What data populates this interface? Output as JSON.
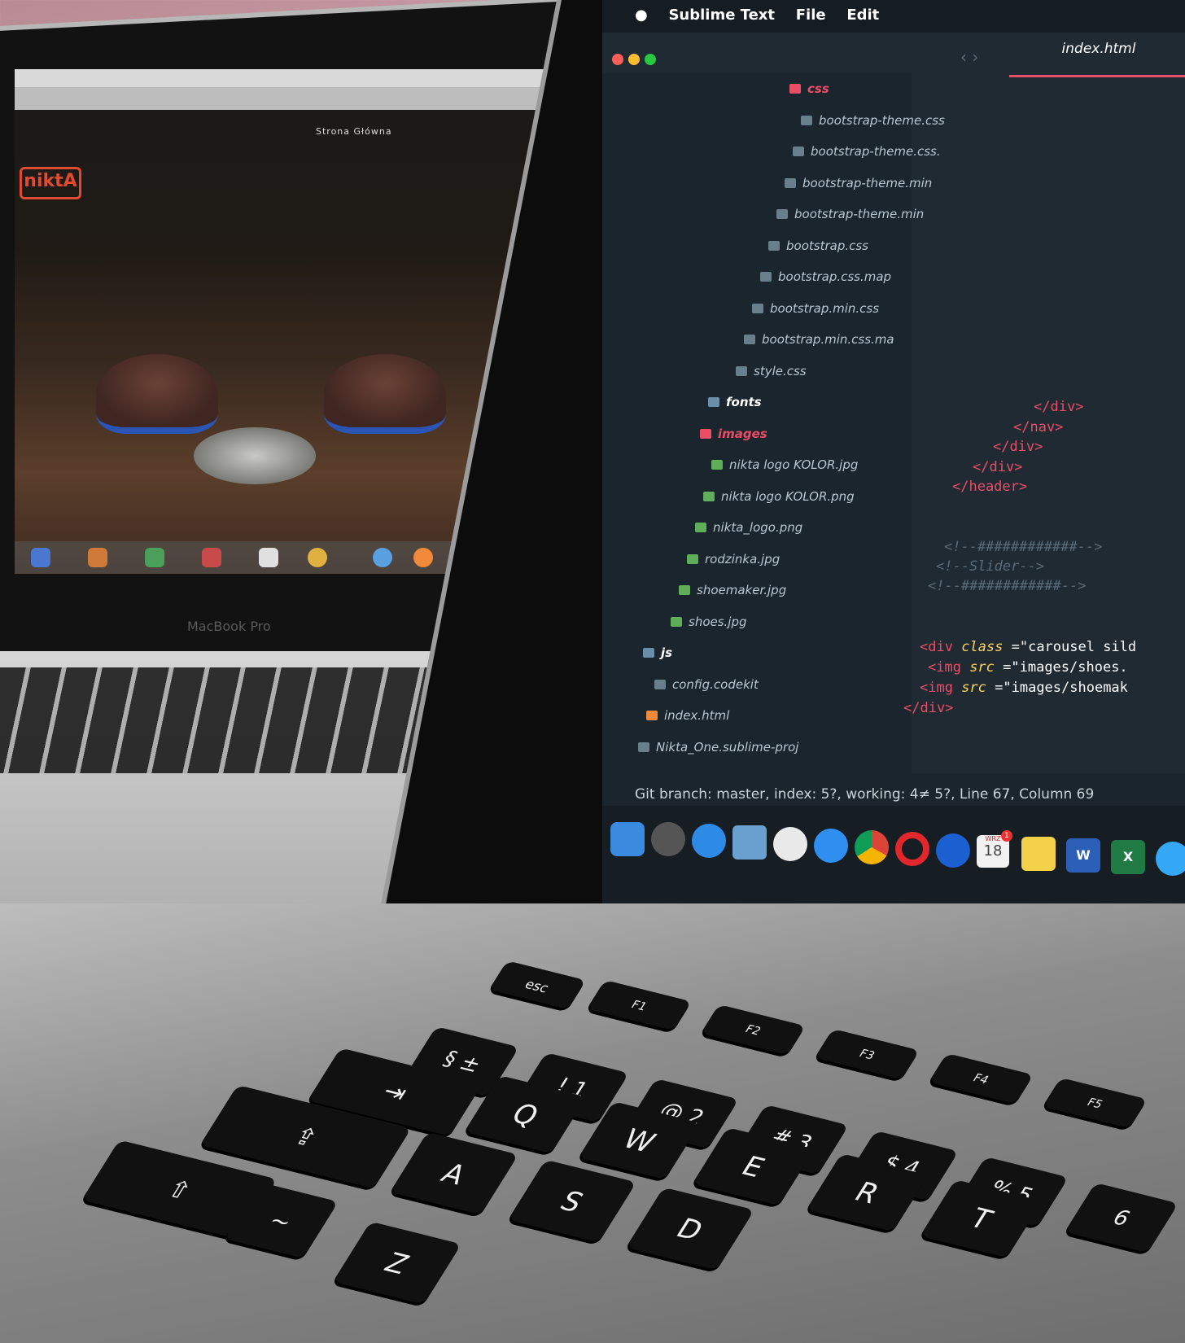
{
  "back_screen": {
    "nav_active": "Strona Główna",
    "logo_text": "niktA",
    "brand": "MacBook Pro"
  },
  "editor": {
    "menu": [
      "Sublime Text",
      "File",
      "Edit"
    ],
    "tab_title": "index.html",
    "sidebar": [
      {
        "label": "css",
        "kind": "folder-open"
      },
      {
        "label": "bootstrap-theme.css",
        "kind": "file"
      },
      {
        "label": "bootstrap-theme.css.",
        "kind": "file"
      },
      {
        "label": "bootstrap-theme.min",
        "kind": "file"
      },
      {
        "label": "bootstrap-theme.min",
        "kind": "file"
      },
      {
        "label": "bootstrap.css",
        "kind": "file"
      },
      {
        "label": "bootstrap.css.map",
        "kind": "file"
      },
      {
        "label": "bootstrap.min.css",
        "kind": "file"
      },
      {
        "label": "bootstrap.min.css.ma",
        "kind": "file"
      },
      {
        "label": "style.css",
        "kind": "file"
      },
      {
        "label": "fonts",
        "kind": "folder"
      },
      {
        "label": "images",
        "kind": "folder-open"
      },
      {
        "label": "nikta logo KOLOR.jpg",
        "kind": "image"
      },
      {
        "label": "nikta logo KOLOR.png",
        "kind": "image"
      },
      {
        "label": "nikta_logo.png",
        "kind": "image"
      },
      {
        "label": "rodzinka.jpg",
        "kind": "image"
      },
      {
        "label": "shoemaker.jpg",
        "kind": "image"
      },
      {
        "label": "shoes.jpg",
        "kind": "image"
      },
      {
        "label": "js",
        "kind": "folder"
      },
      {
        "label": "config.codekit",
        "kind": "file"
      },
      {
        "label": "index.html",
        "kind": "html"
      },
      {
        "label": "Nikta_One.sublime-proj",
        "kind": "project"
      }
    ],
    "code_lines": [
      {
        "text": "</div>",
        "cls": "tag"
      },
      {
        "text": "</nav>",
        "cls": "tag"
      },
      {
        "text": "</div>",
        "cls": "tag"
      },
      {
        "text": "</div>",
        "cls": "tag"
      },
      {
        "text": "</header>",
        "cls": "tag"
      },
      {
        "text": "<!--############-->",
        "cls": "cmt"
      },
      {
        "text": "<!--Slider-->",
        "cls": "cmt"
      },
      {
        "text": "<!--############-->",
        "cls": "cmt"
      }
    ],
    "code_tail": {
      "div_tag": "<div",
      "class_attr": "class",
      "class_value": "=\"carousel sild",
      "img_tag": "<img",
      "src_attr": "src",
      "src_value_1": "=\"images/shoes.",
      "src_value_2": "=\"images/shoemak",
      "close_div": "</div>"
    },
    "status": "Git branch: master, index: 5?, working: 4≠ 5?, Line 67, Column 69"
  },
  "dock_calendar": {
    "month": "WRZ",
    "day": "18",
    "badge": "1"
  },
  "keyboard": {
    "esc": "esc",
    "row_numbers": [
      "§ ±",
      "! 1",
      "@ 2",
      "# 3",
      "$ 4",
      "% 5",
      "6"
    ],
    "row_fn": [
      "F1",
      "F2",
      "F3",
      "F4",
      "F5"
    ],
    "row_q": [
      "Q",
      "W",
      "E",
      "R",
      "T"
    ],
    "row_a": [
      "A",
      "S",
      "D"
    ],
    "tab_glyph": "⇥",
    "shift_glyph": "⇧",
    "caps_glyph": "⇪",
    "z": "Z",
    "tilde": "~"
  },
  "colors": {
    "accent": "#ea4d66",
    "editor_bg": "#1f2a33",
    "sidebar_bg": "#1b252d"
  }
}
